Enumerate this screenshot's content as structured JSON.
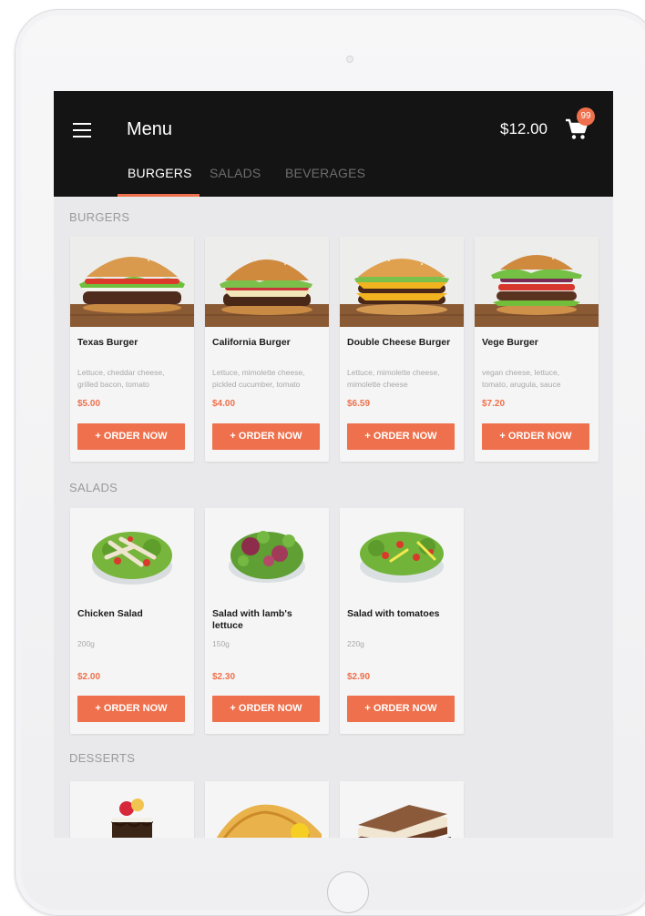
{
  "header": {
    "title": "Menu",
    "cart_total": "$12.00",
    "cart_badge": "99"
  },
  "tabs": [
    {
      "label": "BURGERS",
      "active": true
    },
    {
      "label": "SALADS",
      "active": false
    },
    {
      "label": "BEVERAGES",
      "active": false
    }
  ],
  "colors": {
    "accent": "#ee704c",
    "appbar": "#141414",
    "background": "#e9e9eb"
  },
  "sections": {
    "burgers": {
      "title": "BURGERS",
      "items": [
        {
          "name": "Texas Burger",
          "desc1": "Lettuce, cheddar cheese,",
          "desc2": "grilled bacon, tomato",
          "price": "$5.00",
          "button": "+ ORDER NOW"
        },
        {
          "name": "California Burger",
          "desc1": "Lettuce, mimolette cheese,",
          "desc2": "pickled cucumber, tomato",
          "price": "$4.00",
          "button": "+ ORDER NOW"
        },
        {
          "name": "Double Cheese Burger",
          "desc1": "Lettuce, mimolette cheese,",
          "desc2": "mimolette cheese",
          "price": "$6.59",
          "button": "+ ORDER NOW"
        },
        {
          "name": "Vege Burger",
          "desc1": "vegan cheese, lettuce,",
          "desc2": "tomato, arugula, sauce",
          "price": "$7.20",
          "button": "+ ORDER NOW"
        }
      ]
    },
    "salads": {
      "title": "SALADS",
      "items": [
        {
          "name": "Chicken Salad",
          "weight": "200g",
          "price": "$2.00",
          "button": "+ ORDER NOW"
        },
        {
          "name": "Salad with lamb's lettuce",
          "weight": "150g",
          "price": "$2.30",
          "button": "+ ORDER NOW"
        },
        {
          "name": "Salad with tomatoes",
          "weight": "220g",
          "price": "$2.90",
          "button": "+ ORDER NOW"
        }
      ]
    },
    "desserts": {
      "title": "DESSERTS"
    }
  },
  "icons": {
    "menu": "hamburger-menu-icon",
    "cart": "shopping-cart-icon"
  }
}
